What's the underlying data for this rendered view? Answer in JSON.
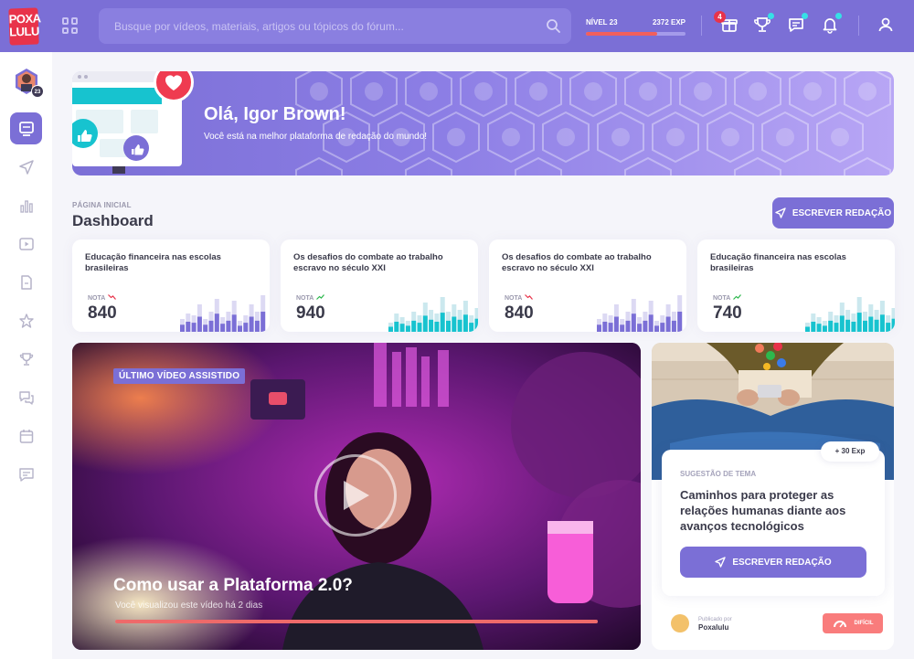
{
  "brand": {
    "logo_line1": "POXA",
    "logo_line2": "LULU"
  },
  "search": {
    "placeholder": "Busque por vídeos, materiais, artigos ou tópicos do fórum..."
  },
  "level": {
    "label": "NÍVEL 23",
    "exp": "2372 EXP",
    "progress_fraction": 0.72
  },
  "header_icons": [
    {
      "name": "gift-icon",
      "badge": "4"
    },
    {
      "name": "trophy-icon"
    },
    {
      "name": "chat-icon"
    },
    {
      "name": "bell-icon"
    },
    {
      "name": "user-icon"
    }
  ],
  "sidebar": {
    "avatar_level": "23",
    "items": [
      {
        "name": "dashboard-icon",
        "active": true
      },
      {
        "name": "send-icon"
      },
      {
        "name": "bar-chart-icon"
      },
      {
        "name": "video-icon"
      },
      {
        "name": "document-icon"
      },
      {
        "name": "star-icon"
      },
      {
        "name": "trophy-icon"
      },
      {
        "name": "forum-icon"
      },
      {
        "name": "calendar-icon"
      },
      {
        "name": "message-icon"
      }
    ]
  },
  "hero": {
    "greeting": "Olá, Igor Brown!",
    "subtitle": "Você está na melhor plataforma de redação do mundo!"
  },
  "page": {
    "breadcrumb": "PÁGINA INICIAL",
    "title": "Dashboard",
    "write_button": "ESCREVER REDAÇÃO"
  },
  "cards": [
    {
      "title": "Educação financeira nas escolas brasileiras",
      "nota_label": "NOTA",
      "score": "840",
      "trend": "down",
      "accent": "#7b6fd6",
      "light": "#dcd9f3",
      "bars": [
        0.35,
        0.5,
        0.45,
        0.75,
        0.35,
        0.55,
        0.9,
        0.4,
        0.55,
        0.85,
        0.3,
        0.45,
        0.75,
        0.55,
        1.0
      ]
    },
    {
      "title": "Os desafios do combate ao trabalho escravo no século XXI",
      "nota_label": "NOTA",
      "score": "940",
      "trend": "up",
      "accent": "#17c3cf",
      "light": "#cbe8ee",
      "bars": [
        0.25,
        0.5,
        0.4,
        0.3,
        0.55,
        0.45,
        0.8,
        0.6,
        0.5,
        0.95,
        0.55,
        0.75,
        0.6,
        0.85,
        0.45,
        0.65
      ]
    },
    {
      "title": "Os desafios do combate ao trabalho escravo no século XXI",
      "nota_label": "NOTA",
      "score": "840",
      "trend": "down",
      "accent": "#7b6fd6",
      "light": "#dcd9f3",
      "bars": [
        0.35,
        0.5,
        0.45,
        0.75,
        0.35,
        0.55,
        0.9,
        0.4,
        0.55,
        0.85,
        0.3,
        0.45,
        0.75,
        0.55,
        1.0
      ]
    },
    {
      "title": "Educação financeira nas escolas brasileiras",
      "nota_label": "NOTA",
      "score": "740",
      "trend": "up",
      "accent": "#17c3cf",
      "light": "#cbe8ee",
      "bars": [
        0.25,
        0.5,
        0.4,
        0.3,
        0.55,
        0.45,
        0.8,
        0.6,
        0.5,
        0.95,
        0.55,
        0.75,
        0.6,
        0.85,
        0.45,
        0.65
      ]
    }
  ],
  "video": {
    "tag": "ÚLTIMO VÍDEO ASSISTIDO",
    "title": "Como usar a Plataforma 2.0?",
    "subtitle": "Você visualizou este vídeo há 2 dias",
    "progress_fraction": 1.0
  },
  "suggestion": {
    "exp": "+ 30 Exp",
    "label": "SUGESTÃO DE TEMA",
    "title": "Caminhos para proteger as relações humanas diante aos avanços tecnológicos",
    "button": "ESCREVER REDAÇÃO",
    "published_label": "Publicado por",
    "publisher": "Poxalulu",
    "difficulty": "DIFÍCIL"
  },
  "colors": {
    "primary": "#7b6fd6",
    "danger": "#f97c7c",
    "teal": "#17c3cf"
  }
}
